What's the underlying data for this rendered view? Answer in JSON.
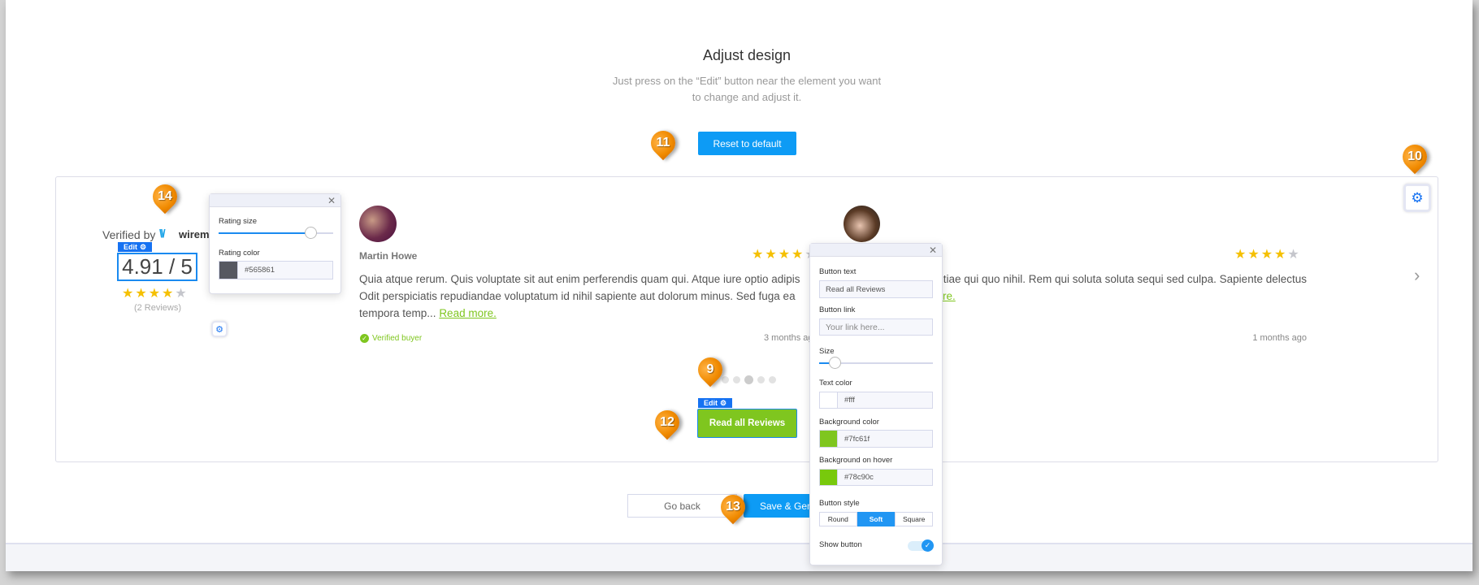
{
  "header": {
    "title": "Adjust design",
    "subtitle_line1": "Just press on the “Edit” button near the element you want",
    "subtitle_line2": "to change and adjust it.",
    "reset_label": "Reset to default"
  },
  "markers": {
    "m9": "9",
    "m10": "10",
    "m11": "11",
    "m12": "12",
    "m13": "13",
    "m14": "14"
  },
  "summary": {
    "verified_by": "Verified by",
    "brand": "wireme",
    "edit_label": "Edit",
    "rating": "4.91 / 5",
    "stars": 4,
    "reviews_count": "(2 Reviews)"
  },
  "rating_popup": {
    "size_label": "Rating size",
    "size_value": 0.8,
    "color_label": "Rating color",
    "color_value": "#565861"
  },
  "reviews": [
    {
      "name": "Martin Howe",
      "stars": 4,
      "line1": "Quia atque rerum. Quis voluptate sit aut enim perferendis quam qui. Atque iure optio adipis",
      "line2": "Odit perspiciatis repudiandae voluptatum id nihil sapiente aut dolorum minus. Sed fuga ea",
      "line3": "tempora temp...",
      "read_more": "Read more.",
      "verified": "Verified buyer",
      "time": "3 months ago"
    },
    {
      "stars": 4,
      "line1": "tiae qui quo nihil. Rem qui soluta soluta sequi sed culpa. Sapiente delectus",
      "read_more_tail": "re.",
      "time": "1 months ago"
    }
  ],
  "carousel": {
    "dots": 5,
    "active_dot": 3
  },
  "cta": {
    "edit_label": "Edit",
    "label": "Read all Reviews"
  },
  "button_popup": {
    "text_label": "Button text",
    "text_value": "Read all Reviews",
    "link_label": "Button link",
    "link_placeholder": "Your link here...",
    "size_label": "Size",
    "size_value": 0.13,
    "text_color_label": "Text color",
    "text_color": "#fff",
    "bg_label": "Background color",
    "bg_color": "#7fc61f",
    "hover_label": "Background on hover",
    "hover_color": "#78c90c",
    "style_label": "Button style",
    "styles": [
      "Round",
      "Soft",
      "Square"
    ],
    "selected_style": "Soft",
    "show_label": "Show button",
    "show_enabled": true
  },
  "footer": {
    "back_label": "Go back",
    "save_label": "Save & Generate"
  },
  "colors": {
    "accent": "#0d9bf5",
    "edit_blue": "#1672f2",
    "green": "#7fc61f",
    "star": "#f5c000",
    "marker": "#f08a00"
  }
}
